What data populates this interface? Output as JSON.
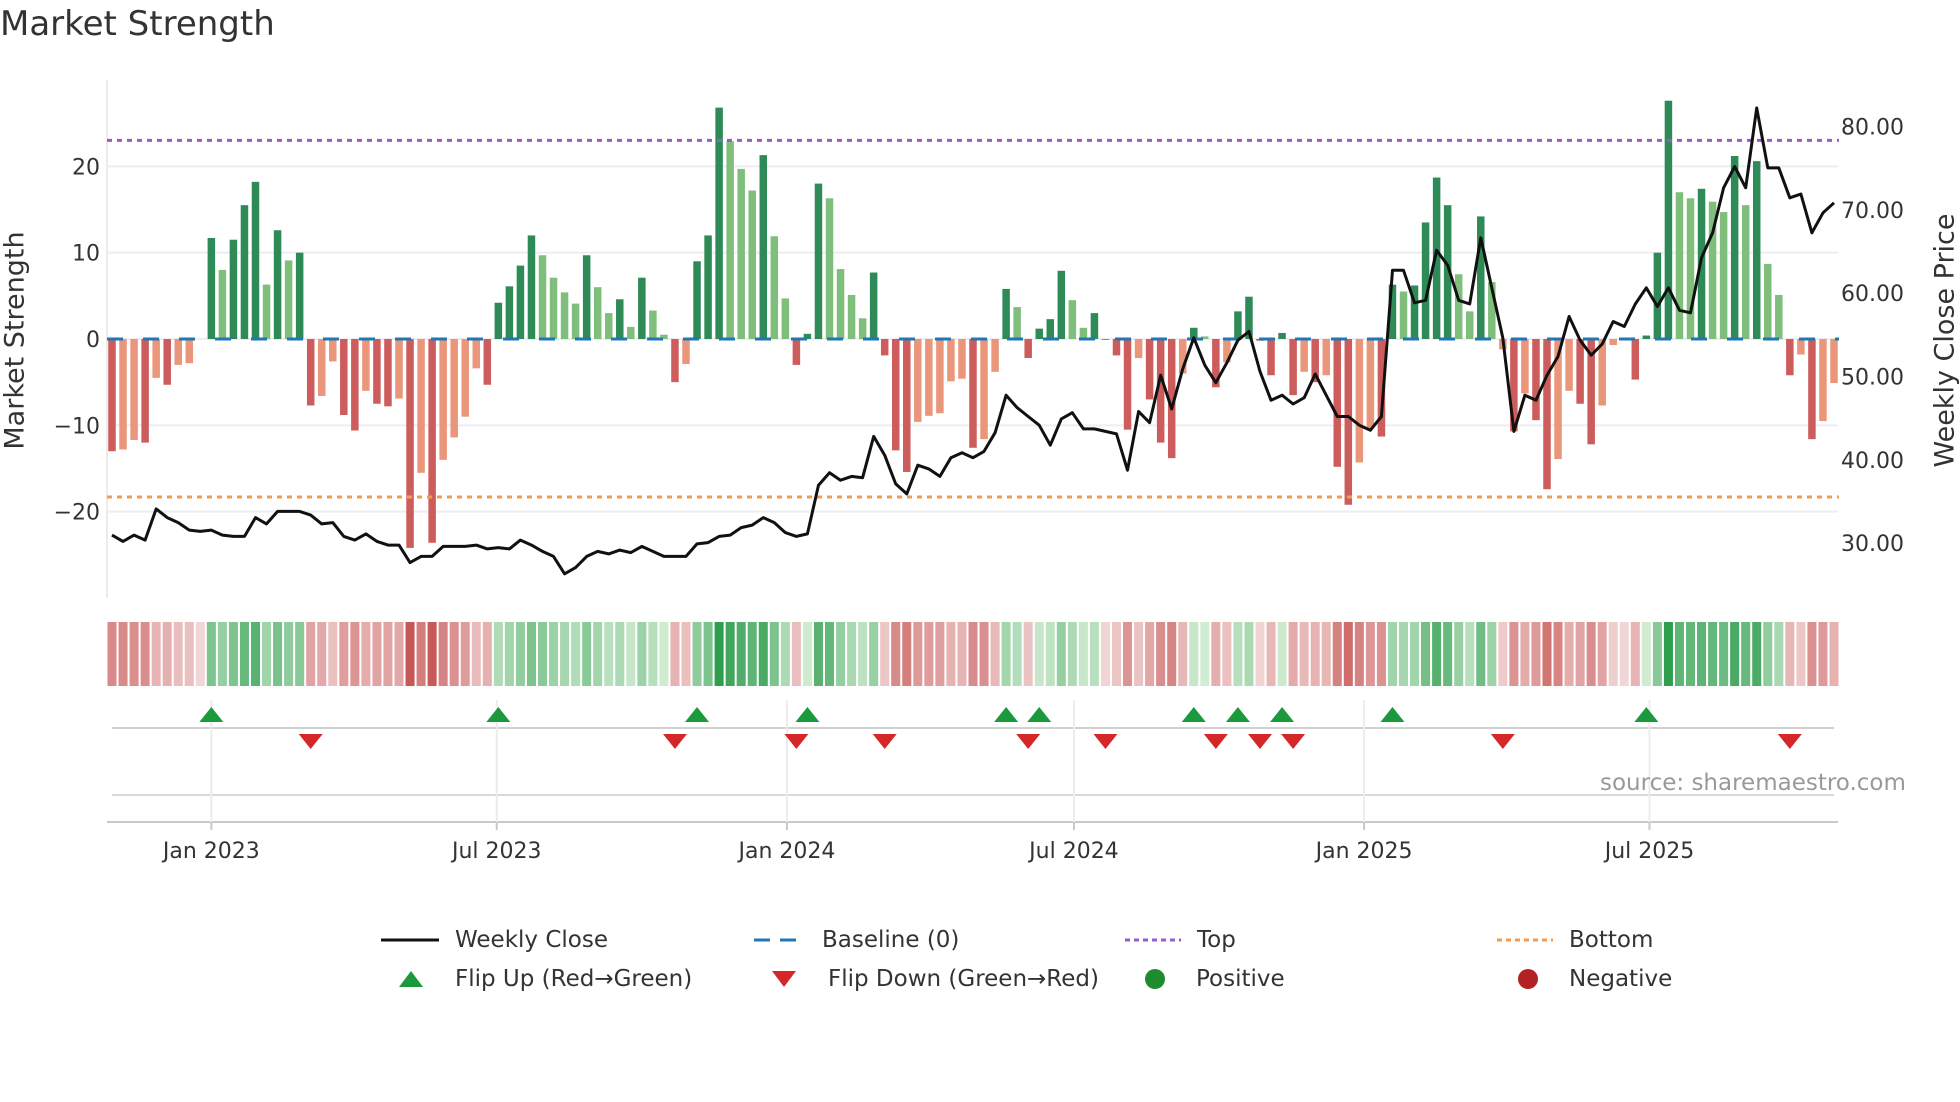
{
  "title": "Market Strength",
  "source": "source: sharemaestro.com",
  "chart_data": {
    "type": "bar+line",
    "title": "Market Strength",
    "ylabel": "Market Strength",
    "y2label": "Weekly Close Price",
    "ylim": [
      -30,
      30
    ],
    "y2lim": [
      23.4,
      85.6
    ],
    "yticks": [
      -20,
      -10,
      0,
      10,
      20
    ],
    "y2ticks": [
      "30.00",
      "40.00",
      "50.00",
      "60.00",
      "70.00",
      "80.00"
    ],
    "start_week": "2022-10-30",
    "xticks": [
      {
        "label": "Jan 2023",
        "date": "2023-01-01"
      },
      {
        "label": "Jul 2023",
        "date": "2023-07-01"
      },
      {
        "label": "Jan 2024",
        "date": "2024-01-01"
      },
      {
        "label": "Jul 2024",
        "date": "2024-07-01"
      },
      {
        "label": "Jan 2025",
        "date": "2025-01-01"
      },
      {
        "label": "Jul 2025",
        "date": "2025-07-01"
      }
    ],
    "top_line": 23.0,
    "bottom_line": -18.3,
    "baseline": 0,
    "strength": [
      -13,
      -12.8,
      -11.7,
      -12,
      -4.5,
      -5.3,
      -3,
      -2.8,
      0,
      11.7,
      8,
      11.5,
      15.5,
      18.2,
      6.3,
      12.6,
      9.1,
      10,
      -7.7,
      -6.6,
      -2.6,
      -8.8,
      -10.6,
      -6,
      -7.5,
      -7.8,
      -6.9,
      -24.2,
      -15.5,
      -23.6,
      -14,
      -11.4,
      -9,
      -3.4,
      -5.3,
      4.2,
      6.1,
      8.5,
      12,
      9.7,
      7.1,
      5.4,
      4.1,
      9.7,
      6,
      3,
      4.6,
      1.4,
      7.1,
      3.3,
      0.5,
      -5,
      -2.9,
      9,
      12,
      26.8,
      22.9,
      19.7,
      17.2,
      21.3,
      11.9,
      4.7,
      -3,
      0.6,
      18,
      16.3,
      8.1,
      5.1,
      2.4,
      7.7,
      -1.9,
      -12.9,
      -15.4,
      -9.6,
      -8.9,
      -8.6,
      -4.9,
      -4.6,
      -12.6,
      -11.6,
      -3.8,
      5.8,
      3.7,
      -2.2,
      1.2,
      2.3,
      7.9,
      4.5,
      1.3,
      3.0,
      -0.1,
      -1.9,
      -10.5,
      -2.2,
      -7,
      -12,
      -13.8,
      -4,
      1.3,
      0.3,
      -5.6,
      -2.7,
      3.2,
      4.9,
      -0.2,
      -4.2,
      0.7,
      -6.5,
      -3.8,
      -5,
      -4.2,
      -14.8,
      -19.2,
      -14.3,
      -10.4,
      -11.3,
      6.3,
      5.5,
      6.2,
      13.5,
      18.7,
      15.5,
      7.5,
      3.2,
      14.2,
      6.6,
      -1.2,
      -10.7,
      -6.3,
      -9.4,
      -17.4,
      -13.9,
      -6,
      -7.5,
      -12.2,
      -7.7,
      -0.7,
      0,
      -4.7,
      0.4,
      10,
      27.6,
      17,
      16.3,
      17.4,
      15.9,
      14.7,
      21.2,
      15.5,
      20.6,
      8.7,
      5.1,
      -4.2,
      -1.8,
      -11.6,
      -9.5,
      -5.1
    ],
    "strong": [
      1,
      0,
      0,
      1,
      0,
      1,
      0,
      0,
      0,
      1,
      0,
      1,
      1,
      1,
      0,
      1,
      0,
      1,
      1,
      0,
      0,
      1,
      1,
      0,
      1,
      1,
      0,
      1,
      0,
      1,
      0,
      0,
      0,
      0,
      1,
      1,
      1,
      1,
      1,
      0,
      0,
      0,
      0,
      1,
      0,
      0,
      1,
      0,
      1,
      0,
      0,
      1,
      0,
      1,
      1,
      1,
      0,
      0,
      0,
      1,
      0,
      0,
      1,
      1,
      1,
      0,
      0,
      0,
      0,
      1,
      1,
      1,
      1,
      0,
      0,
      0,
      0,
      0,
      1,
      0,
      0,
      1,
      0,
      1,
      1,
      1,
      1,
      0,
      0,
      1,
      1,
      1,
      1,
      0,
      1,
      1,
      1,
      0,
      1,
      0,
      1,
      0,
      1,
      1,
      1,
      1,
      1,
      1,
      0,
      1,
      0,
      1,
      1,
      0,
      0,
      1,
      1,
      0,
      1,
      1,
      1,
      1,
      0,
      0,
      1,
      0,
      0,
      1,
      0,
      1,
      1,
      0,
      0,
      1,
      1,
      0,
      0,
      0,
      1,
      1,
      1,
      1,
      0,
      0,
      1,
      0,
      0,
      1,
      0,
      1,
      0,
      0,
      1,
      0,
      1,
      0,
      0
    ],
    "weekly_close": [
      30.95,
      30.2,
      30.95,
      30.35,
      34.1,
      33.05,
      32.45,
      31.55,
      31.4,
      31.55,
      30.95,
      30.8,
      30.8,
      33.05,
      32.3,
      33.8,
      33.8,
      33.8,
      33.35,
      32.3,
      32.45,
      30.8,
      30.35,
      31.1,
      30.2,
      29.75,
      29.75,
      27.65,
      28.4,
      28.4,
      29.6,
      29.6,
      29.6,
      29.75,
      29.3,
      29.45,
      29.3,
      30.35,
      29.75,
      29.0,
      28.4,
      26.3,
      27.05,
      28.4,
      29.0,
      28.7,
      29.15,
      28.85,
      29.6,
      29.0,
      28.4,
      28.4,
      28.4,
      29.9,
      30.05,
      30.8,
      30.95,
      31.85,
      32.15,
      33.05,
      32.45,
      31.25,
      30.8,
      31.1,
      36.95,
      38.45,
      37.55,
      38.0,
      37.85,
      42.8,
      40.55,
      37.1,
      35.9,
      39.35,
      38.9,
      38.0,
      40.25,
      40.85,
      40.25,
      41.0,
      43.25,
      47.75,
      46.25,
      45.2,
      44.15,
      41.75,
      44.9,
      45.65,
      43.7,
      43.7,
      43.4,
      43.1,
      38.75,
      45.8,
      44.45,
      50.15,
      46.1,
      50.9,
      54.65,
      51.35,
      49.25,
      51.65,
      54.35,
      55.4,
      50.6,
      47.15,
      47.75,
      46.7,
      47.45,
      50.3,
      47.75,
      45.2,
      45.2,
      44.15,
      43.55,
      45.2,
      62.75,
      62.75,
      58.85,
      59.15,
      65.15,
      63.35,
      59.15,
      58.7,
      66.65,
      60.65,
      54.65,
      43.4,
      47.75,
      47.15,
      50.15,
      52.4,
      57.2,
      54.35,
      52.55,
      53.9,
      56.6,
      56.0,
      58.7,
      60.65,
      58.4,
      60.65,
      57.95,
      57.65,
      64.25,
      67.25,
      72.65,
      75.2,
      72.65,
      82.25,
      75.05,
      75.05,
      71.45,
      71.9,
      67.25,
      69.65,
      70.85
    ],
    "flip_up_weeks": [
      9,
      35,
      53,
      63,
      81,
      84,
      98,
      102,
      106,
      116,
      139
    ],
    "flip_down_weeks": [
      18,
      51,
      62,
      70,
      83,
      90,
      100,
      104,
      107,
      126,
      152
    ],
    "legend": [
      {
        "label": "Weekly Close",
        "kind": "line",
        "color": "#111111"
      },
      {
        "label": "Baseline (0)",
        "kind": "dash",
        "color": "#1f77b4"
      },
      {
        "label": "Top",
        "kind": "dot",
        "color": "#9b59d0"
      },
      {
        "label": "Bottom",
        "kind": "dot",
        "color": "#f39c4f"
      },
      {
        "label": "Flip Up (Red→Green)",
        "kind": "tri-up",
        "color": "#1a9a3c"
      },
      {
        "label": "Flip Down (Green→Red)",
        "kind": "tri-down",
        "color": "#d62728"
      },
      {
        "label": "Positive",
        "kind": "circle",
        "color": "#1e8c2e"
      },
      {
        "label": "Negative",
        "kind": "circle",
        "color": "#b22222"
      }
    ],
    "colors": {
      "pos_strong": "#2e8b57",
      "pos_weak": "#7fbf7b",
      "neg_strong": "#cd5c5c",
      "neg_weak": "#e9967a",
      "line": "#111111",
      "baseline": "#1f77b4",
      "top": "#9b59d0",
      "bottom": "#f39c4f"
    }
  }
}
